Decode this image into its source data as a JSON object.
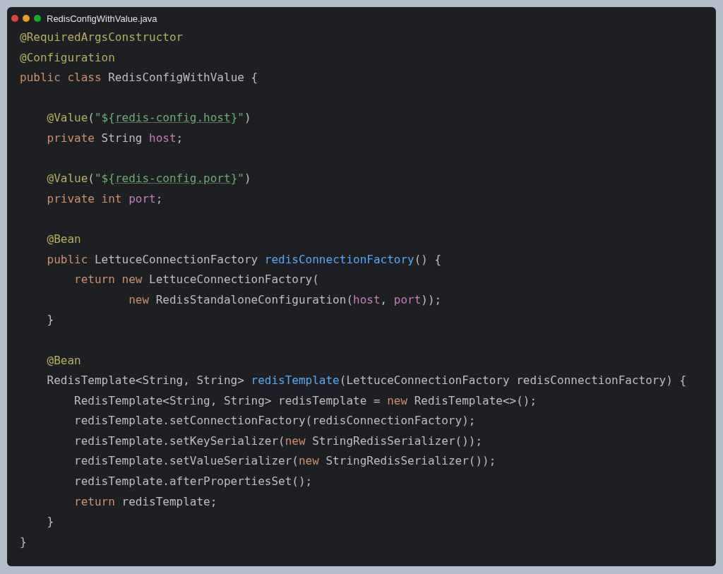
{
  "window": {
    "title": "RedisConfigWithValue.java"
  },
  "code": {
    "lines": [
      {
        "kind": "code",
        "tokens": [
          {
            "kind": "annotation",
            "text": "@RequiredArgsConstructor"
          }
        ]
      },
      {
        "kind": "code",
        "tokens": [
          {
            "kind": "annotation",
            "text": "@Configuration"
          }
        ]
      },
      {
        "kind": "code",
        "tokens": [
          {
            "kind": "keyword",
            "text": "public class "
          },
          {
            "kind": "plain",
            "text": "RedisConfigWithValue {"
          }
        ]
      },
      {
        "kind": "blank"
      },
      {
        "kind": "code",
        "tokens": [
          {
            "kind": "annotation",
            "text": "    @Value"
          },
          {
            "kind": "plain",
            "text": "("
          },
          {
            "kind": "string",
            "text": "\"${"
          },
          {
            "kind": "reference",
            "text": "redis-config.host"
          },
          {
            "kind": "string",
            "text": "}\""
          },
          {
            "kind": "plain",
            "text": ")"
          }
        ]
      },
      {
        "kind": "code",
        "tokens": [
          {
            "kind": "keyword",
            "text": "    private "
          },
          {
            "kind": "plain",
            "text": "String "
          },
          {
            "kind": "field",
            "text": "host"
          },
          {
            "kind": "plain",
            "text": ";"
          }
        ]
      },
      {
        "kind": "blank"
      },
      {
        "kind": "code",
        "tokens": [
          {
            "kind": "annotation",
            "text": "    @Value"
          },
          {
            "kind": "plain",
            "text": "("
          },
          {
            "kind": "string",
            "text": "\"${"
          },
          {
            "kind": "reference",
            "text": "redis-config.port"
          },
          {
            "kind": "string",
            "text": "}\""
          },
          {
            "kind": "plain",
            "text": ")"
          }
        ]
      },
      {
        "kind": "code",
        "tokens": [
          {
            "kind": "keyword",
            "text": "    private int "
          },
          {
            "kind": "field",
            "text": "port"
          },
          {
            "kind": "plain",
            "text": ";"
          }
        ]
      },
      {
        "kind": "blank"
      },
      {
        "kind": "code",
        "tokens": [
          {
            "kind": "annotation",
            "text": "    @Bean"
          }
        ]
      },
      {
        "kind": "code",
        "tokens": [
          {
            "kind": "keyword",
            "text": "    public "
          },
          {
            "kind": "plain",
            "text": "LettuceConnectionFactory "
          },
          {
            "kind": "method",
            "text": "redisConnectionFactory"
          },
          {
            "kind": "plain",
            "text": "() {"
          }
        ]
      },
      {
        "kind": "code",
        "tokens": [
          {
            "kind": "keyword",
            "text": "        return new "
          },
          {
            "kind": "plain",
            "text": "LettuceConnectionFactory("
          }
        ]
      },
      {
        "kind": "code",
        "tokens": [
          {
            "kind": "keyword",
            "text": "                new "
          },
          {
            "kind": "plain",
            "text": "RedisStandaloneConfiguration("
          },
          {
            "kind": "field",
            "text": "host"
          },
          {
            "kind": "plain",
            "text": ", "
          },
          {
            "kind": "field",
            "text": "port"
          },
          {
            "kind": "plain",
            "text": "));"
          }
        ]
      },
      {
        "kind": "code",
        "tokens": [
          {
            "kind": "plain",
            "text": "    }"
          }
        ]
      },
      {
        "kind": "blank"
      },
      {
        "kind": "code",
        "tokens": [
          {
            "kind": "annotation",
            "text": "    @Bean"
          }
        ]
      },
      {
        "kind": "code",
        "tokens": [
          {
            "kind": "plain",
            "text": "    RedisTemplate<String, String> "
          },
          {
            "kind": "method",
            "text": "redisTemplate"
          },
          {
            "kind": "plain",
            "text": "(LettuceConnectionFactory redisConnectionFactory) {"
          }
        ]
      },
      {
        "kind": "code",
        "tokens": [
          {
            "kind": "plain",
            "text": "        RedisTemplate<String, String> redisTemplate = "
          },
          {
            "kind": "keyword",
            "text": "new "
          },
          {
            "kind": "plain",
            "text": "RedisTemplate<>();"
          }
        ]
      },
      {
        "kind": "code",
        "tokens": [
          {
            "kind": "plain",
            "text": "        redisTemplate.setConnectionFactory(redisConnectionFactory);"
          }
        ]
      },
      {
        "kind": "code",
        "tokens": [
          {
            "kind": "plain",
            "text": "        redisTemplate.setKeySerializer("
          },
          {
            "kind": "keyword",
            "text": "new "
          },
          {
            "kind": "plain",
            "text": "StringRedisSerializer());"
          }
        ]
      },
      {
        "kind": "code",
        "tokens": [
          {
            "kind": "plain",
            "text": "        redisTemplate.setValueSerializer("
          },
          {
            "kind": "keyword",
            "text": "new "
          },
          {
            "kind": "plain",
            "text": "StringRedisSerializer());"
          }
        ]
      },
      {
        "kind": "code",
        "tokens": [
          {
            "kind": "plain",
            "text": "        redisTemplate.afterPropertiesSet();"
          }
        ]
      },
      {
        "kind": "code",
        "tokens": [
          {
            "kind": "keyword",
            "text": "        return "
          },
          {
            "kind": "plain",
            "text": "redisTemplate;"
          }
        ]
      },
      {
        "kind": "code",
        "tokens": [
          {
            "kind": "plain",
            "text": "    }"
          }
        ]
      },
      {
        "kind": "code",
        "tokens": [
          {
            "kind": "plain",
            "text": "}"
          }
        ]
      }
    ]
  }
}
